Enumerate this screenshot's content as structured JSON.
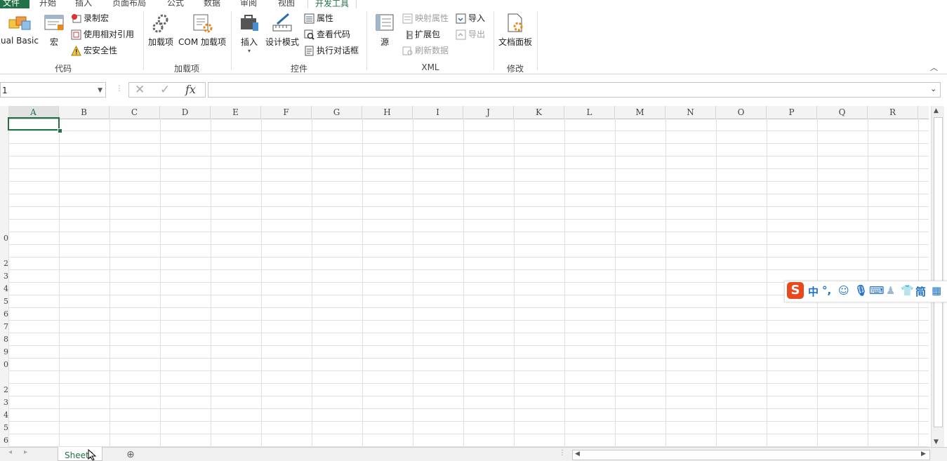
{
  "tabs": {
    "file": "文件",
    "items": [
      "开始",
      "插入",
      "页面布局",
      "公式",
      "数据",
      "审阅",
      "视图"
    ],
    "active": "开发工具"
  },
  "ribbon": {
    "code": {
      "label": "代码",
      "visual_basic": "ual Basic",
      "macro": "宏",
      "record_macro": "录制宏",
      "relative_ref": "使用相对引用",
      "macro_security": "宏安全性"
    },
    "addins": {
      "label": "加载项",
      "addins_btn": "加载项",
      "com_addins": "COM 加载项"
    },
    "controls": {
      "label": "控件",
      "insert": "插入",
      "design_mode": "设计模式",
      "properties": "属性",
      "view_code": "查看代码",
      "run_dialog": "执行对话框"
    },
    "xml": {
      "label": "XML",
      "source": "源",
      "map_props": "映射属性",
      "expansion": "扩展包",
      "refresh": "刷新数据",
      "import": "导入",
      "export": "导出"
    },
    "modify": {
      "label": "修改",
      "doc_panel": "文档面板"
    }
  },
  "formula_bar": {
    "name_box": "1",
    "fx": "fx",
    "value": ""
  },
  "columns": [
    "A",
    "B",
    "C",
    "D",
    "E",
    "F",
    "G",
    "H",
    "I",
    "J",
    "K",
    "L",
    "M",
    "N",
    "O",
    "P",
    "Q",
    "R"
  ],
  "rows": [
    "",
    "",
    "",
    "",
    "",
    "",
    "",
    "",
    "",
    "0",
    "",
    "2",
    "3",
    "4",
    "5",
    "6",
    "7",
    "8",
    "9",
    "0",
    "",
    "2",
    "3",
    "4",
    "5",
    "6"
  ],
  "sheet_tab": "Sheet1",
  "ime": {
    "logo": "S",
    "lang": "中",
    "punct": "°,",
    "simplified": "简"
  },
  "colors": {
    "accent": "#217346",
    "ime_logo": "#e8481c",
    "ime_blue": "#1f6fc5"
  }
}
